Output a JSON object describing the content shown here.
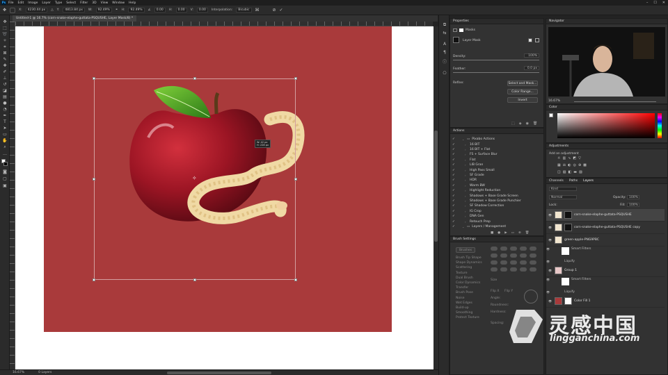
{
  "menu": {
    "logo": "Ps",
    "items": [
      "File",
      "Edit",
      "Image",
      "Layer",
      "Type",
      "Select",
      "Filter",
      "3D",
      "View",
      "Window",
      "Help"
    ]
  },
  "options_bar": {
    "x_value": "4230.44 px",
    "y_value": "4813.84 px",
    "w_value": "92.49%",
    "h_value": "92.49%",
    "angle_value": "0.00",
    "hskew_value": "0.00",
    "vskew_value": "0.00",
    "interpolation_label": "Interpolation:",
    "interpolation_value": "Bicubic"
  },
  "document": {
    "tab_title": "Untitled-1 @ 16.7% (corn-snake-elaphe-guttata-PSQUSHE, Layer Mask/8) *"
  },
  "transform_tooltip": {
    "line1": "W: 42 px",
    "line2": "H: 228 px"
  },
  "status": {
    "zoom": "16.67%",
    "info": "0 Layers"
  },
  "properties": {
    "title": "Properties",
    "masks_label": "Masks",
    "layer_mask_label": "Layer Mask",
    "density_label": "Density:",
    "density_value": "100%",
    "feather_label": "Feather:",
    "feather_value": "0.0 px",
    "refine_label": "Refine:",
    "select_mask_btn": "Select and Mask...",
    "color_range_btn": "Color Range...",
    "invert_btn": "Invert"
  },
  "actions": {
    "title": "Actions",
    "items": [
      {
        "label": "Pixabo Actions",
        "folder": true,
        "indent": 0
      },
      {
        "label": "16 BIT",
        "folder": false,
        "indent": 1
      },
      {
        "label": "16 BIT + Flat",
        "folder": false,
        "indent": 1
      },
      {
        "label": "FS + Surface Blur",
        "folder": false,
        "indent": 1
      },
      {
        "label": "Flat",
        "folder": false,
        "indent": 1
      },
      {
        "label": "LIB Gran",
        "folder": false,
        "indent": 1
      },
      {
        "label": "High Pass Small",
        "folder": false,
        "indent": 1
      },
      {
        "label": "SF Grade",
        "folder": false,
        "indent": 1
      },
      {
        "label": "HDR",
        "folder": false,
        "indent": 1
      },
      {
        "label": "Warm BW",
        "folder": false,
        "indent": 1
      },
      {
        "label": "Highlight Reduction",
        "folder": false,
        "indent": 1
      },
      {
        "label": "Shadows + Base Grade Screen",
        "folder": false,
        "indent": 1
      },
      {
        "label": "Shadows + Base Grade Punchier",
        "folder": false,
        "indent": 1
      },
      {
        "label": "SF Shadow Correction",
        "folder": false,
        "indent": 1
      },
      {
        "label": "IG Crop",
        "folder": false,
        "indent": 1
      },
      {
        "label": "DNA Gen",
        "folder": false,
        "indent": 1
      },
      {
        "label": "Retouch Prep",
        "folder": false,
        "indent": 1
      },
      {
        "label": "Layers / Management",
        "folder": true,
        "indent": 0
      }
    ]
  },
  "brush_settings": {
    "title": "Brush Settings",
    "brushes_btn": "Brushes",
    "items": [
      "Brush Tip Shape",
      "Shape Dynamics",
      "Scattering",
      "Texture",
      "Dual Brush",
      "Color Dynamics",
      "Transfer",
      "Brush Pose",
      "Noise",
      "Wet Edges",
      "Build-up",
      "Smoothing",
      "Protect Texture"
    ],
    "size_label": "Size",
    "flip_x": "Flip X",
    "flip_y": "Flip Y",
    "angle_label": "Angle:",
    "roundness_label": "Roundness:",
    "hardness_label": "Hardness:",
    "spacing_label": "Spacing:"
  },
  "navigator": {
    "title": "Navigator",
    "zoom": "16.67%"
  },
  "color_panel": {
    "title": "Color"
  },
  "adjustments": {
    "title": "Adjustments",
    "subtitle": "Add an adjustment"
  },
  "layers_panel": {
    "tabs": [
      "Channels",
      "Paths",
      "Layers"
    ],
    "kind_label": "Kind",
    "blend_mode": "Normal",
    "opacity_label": "Opacity:",
    "opacity_value": "100%",
    "lock_label": "Lock:",
    "fill_label": "Fill:",
    "fill_value": "100%",
    "layers": [
      {
        "name": "corn-snake-elaphe-guttata-PSQUSHE",
        "type": "masked"
      },
      {
        "name": "corn-snake-elaphe-guttata-PSQUSHE copy",
        "type": "masked"
      },
      {
        "name": "green-apple-PNG9PBC",
        "type": "smart"
      },
      {
        "name": "Smart Filters",
        "type": "sub"
      },
      {
        "name": "Liquify",
        "type": "subsub"
      },
      {
        "name": "Group 1",
        "type": "group"
      },
      {
        "name": "Smart Filters",
        "type": "sub"
      },
      {
        "name": "Liquify",
        "type": "subsub"
      },
      {
        "name": "Color Fill 1",
        "type": "fill"
      }
    ]
  },
  "watermark": {
    "cn": "灵感中国",
    "en": "lingganchina.com"
  },
  "colors": {
    "artboard": "#a93a3b",
    "accent": "#31a8ff"
  }
}
